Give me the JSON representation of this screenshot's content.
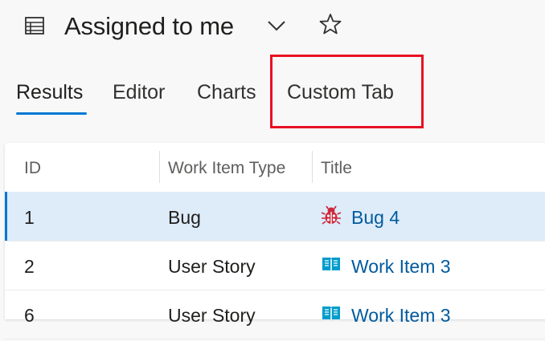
{
  "header": {
    "title": "Assigned to me",
    "icons": {
      "query": "query-list-icon",
      "chevron": "chevron-down-icon",
      "favorite": "star-outline-icon"
    }
  },
  "tabs": [
    {
      "label": "Results",
      "selected": true
    },
    {
      "label": "Editor",
      "selected": false
    },
    {
      "label": "Charts",
      "selected": false
    },
    {
      "label": "Custom Tab",
      "selected": false,
      "highlighted": true
    }
  ],
  "grid": {
    "columns": [
      "ID",
      "Work Item Type",
      "Title"
    ],
    "rows": [
      {
        "id": "1",
        "type": "Bug",
        "title": "Bug 4",
        "icon": "bug-icon",
        "selected": true
      },
      {
        "id": "2",
        "type": "User Story",
        "title": "Work Item 3",
        "icon": "book-icon",
        "selected": false
      },
      {
        "id": "6",
        "type": "User Story",
        "title": "Work Item 3",
        "icon": "book-icon",
        "selected": false
      }
    ]
  },
  "colors": {
    "accent": "#0078d4",
    "link": "#005a9e",
    "bug": "#cc293d",
    "user_story": "#009ccc",
    "highlight_box": "#e81123",
    "selected_row": "#deecf9"
  }
}
